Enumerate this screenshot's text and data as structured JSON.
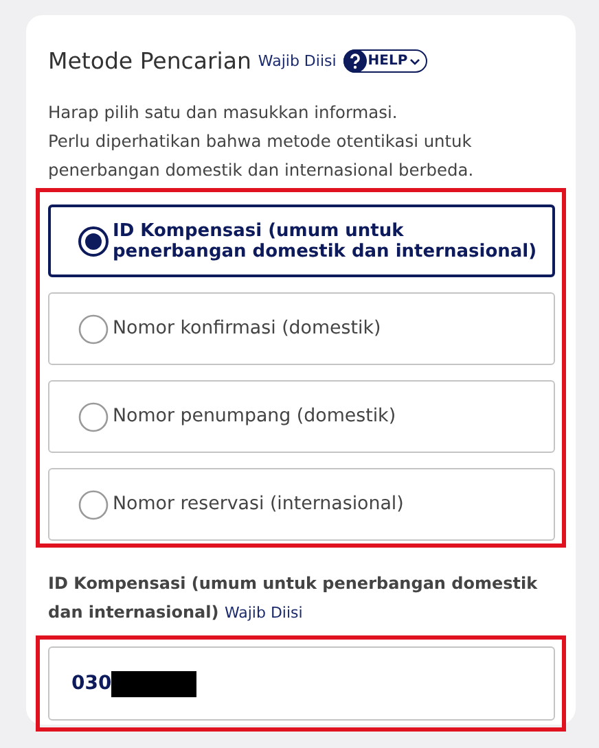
{
  "section": {
    "title": "Metode Pencarian",
    "required": "Wajib Diisi",
    "help": "HELP"
  },
  "description": [
    "Harap pilih satu dan masukkan informasi.",
    "Perlu diperhatikan bahwa metode otentikasi untuk penerbangan domestik dan internasional berbeda."
  ],
  "options_highlighted": true,
  "options": [
    {
      "label": "ID Kompensasi (umum untuk penerbangan domestik dan internasional)",
      "selected": true
    },
    {
      "label": "Nomor konfirmasi (domestik)",
      "selected": false
    },
    {
      "label": "Nomor penumpang (domestik)",
      "selected": false
    },
    {
      "label": "Nomor reservasi (internasional)",
      "selected": false
    }
  ],
  "field": {
    "label": "ID Kompensasi (umum untuk penerbangan domestik dan internasional)",
    "required": "Wajib Diisi",
    "value": "030",
    "redacted": true,
    "highlighted": true
  }
}
